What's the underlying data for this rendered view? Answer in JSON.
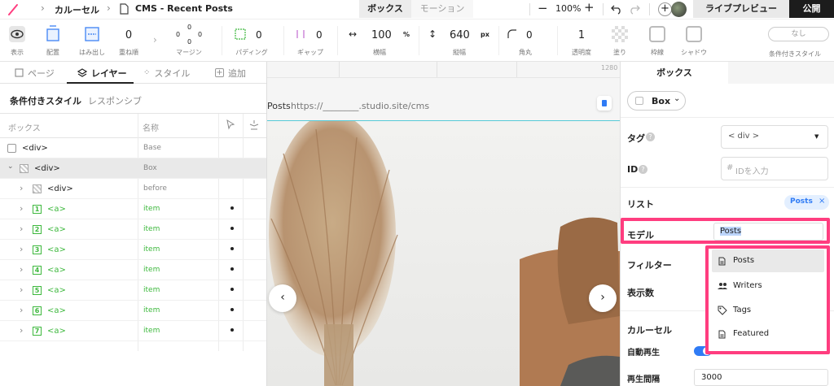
{
  "topbar": {
    "breadcrumb_1": "カルーセル",
    "page_name": "CMS - Recent Posts",
    "tab_box": "ボックス",
    "tab_motion": "モーション",
    "zoom": "100%",
    "live_preview": "ライブプレビュー",
    "publish": "公開"
  },
  "toolbar": {
    "display": "表示",
    "placement": "配置",
    "overflow": "はみ出し",
    "stack_value": "0",
    "stack": "重ね順",
    "margin_top": "0",
    "margin_lr": "0",
    "margin_left": "0",
    "margin_bottom": "0",
    "margin": "マージン",
    "padding_value": "0",
    "padding": "パディング",
    "gap_value": "0",
    "gap": "ギャップ",
    "width_value": "100",
    "width_unit": "%",
    "width": "横幅",
    "height_value": "640",
    "height_unit": "px",
    "height": "縦幅",
    "radius_value": "0",
    "radius": "角丸",
    "opacity_value": "1",
    "opacity": "透明度",
    "fill": "塗り",
    "border": "枠線",
    "shadow": "シャドウ",
    "cond_button": "なし",
    "cond_style": "条件付きスタイル"
  },
  "left": {
    "tabs": [
      "ページ",
      "レイヤー",
      "スタイル",
      "追加"
    ],
    "subtab_active": "条件付きスタイル",
    "subtab_other": "レスポンシブ",
    "col_box": "ボックス",
    "col_name": "名称",
    "rows": [
      {
        "tag": "<div>",
        "name": "Base"
      },
      {
        "tag": "<div>",
        "name": "Box"
      },
      {
        "tag": "<div>",
        "name": "before"
      },
      {
        "tag": "<a>",
        "name": "item",
        "num": "1"
      },
      {
        "tag": "<a>",
        "name": "item",
        "num": "2"
      },
      {
        "tag": "<a>",
        "name": "item",
        "num": "3"
      },
      {
        "tag": "<a>",
        "name": "item",
        "num": "4"
      },
      {
        "tag": "<a>",
        "name": "item",
        "num": "5"
      },
      {
        "tag": "<a>",
        "name": "item",
        "num": "6"
      },
      {
        "tag": "<a>",
        "name": "item",
        "num": "7"
      }
    ]
  },
  "canvas": {
    "ruler_label": "1280",
    "url_prefix": "Posts",
    "url": "https://________.studio.site/cms"
  },
  "right": {
    "tab": "ボックス",
    "box_select": "Box",
    "tag_label": "タグ",
    "tag_value": "< div >",
    "id_label": "ID",
    "id_placeholder": "IDを入力",
    "list_label": "リスト",
    "list_chip": "Posts",
    "model_label": "モデル",
    "model_value": "Posts",
    "filter_label": "フィルター",
    "count_label": "表示数",
    "carousel_label": "カルーセル",
    "autoplay_label": "自動再生",
    "interval_label": "再生間隔",
    "interval_value": "3000",
    "options": [
      "Posts",
      "Writers",
      "Tags",
      "Featured"
    ]
  },
  "colors": {
    "accent": "#ff3d7f",
    "blue": "#2f7bf5",
    "green": "#3db83d",
    "dark": "#1c1c1c"
  }
}
